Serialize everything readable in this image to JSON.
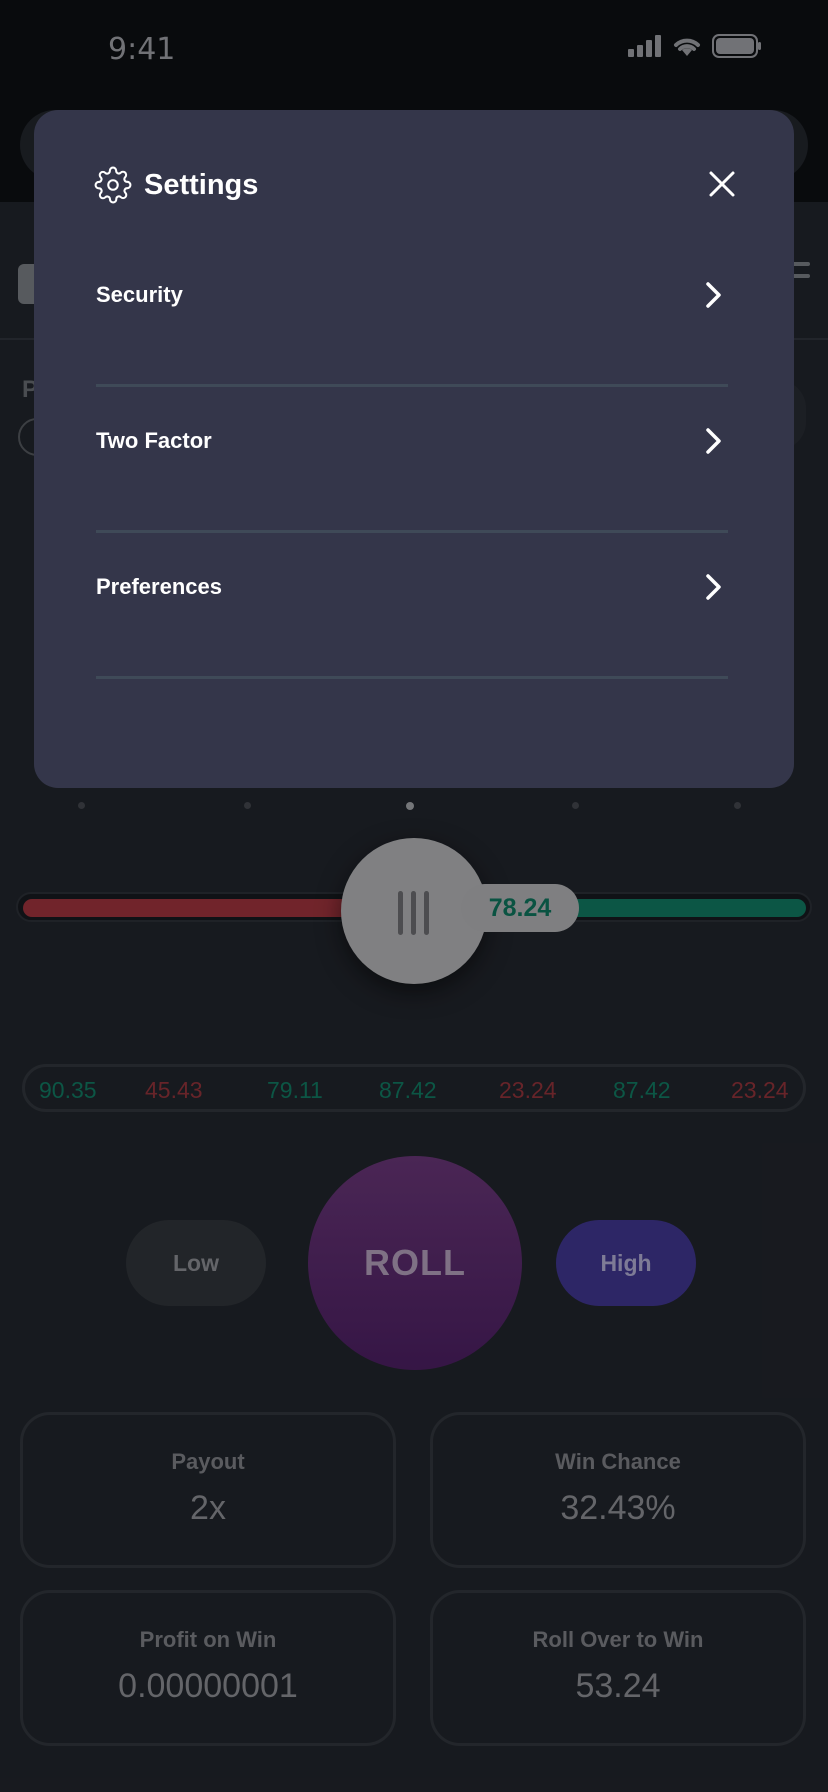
{
  "status_bar": {
    "time": "9:41"
  },
  "background": {
    "slider_value": "78.24",
    "history": [
      {
        "value": "90.35",
        "result": "win"
      },
      {
        "value": "45.43",
        "result": "loss"
      },
      {
        "value": "79.11",
        "result": "win"
      },
      {
        "value": "87.42",
        "result": "win"
      },
      {
        "value": "23.24",
        "result": "loss"
      },
      {
        "value": "87.42",
        "result": "win"
      },
      {
        "value": "23.24",
        "result": "loss"
      }
    ],
    "buttons": {
      "low": "Low",
      "roll": "ROLL",
      "high": "High"
    },
    "stats": {
      "payout": {
        "label": "Payout",
        "value": "2x"
      },
      "win_chance": {
        "label": "Win Chance",
        "value": "32.43%"
      },
      "profit_on_win": {
        "label": "Profit on Win",
        "value": "0.00000001"
      },
      "roll_over": {
        "label": "Roll Over to Win",
        "value": "53.24"
      }
    },
    "partial_label": "P"
  },
  "modal": {
    "title": "Settings",
    "items": [
      {
        "label": "Security"
      },
      {
        "label": "Two Factor"
      },
      {
        "label": "Preferences"
      }
    ]
  },
  "colors": {
    "modal_bg": "#34364a",
    "app_bg": "#1d2026",
    "win": "#0f6a55",
    "loss": "#8a2d35",
    "roll": "#5b2f68",
    "high": "#372f7d"
  }
}
